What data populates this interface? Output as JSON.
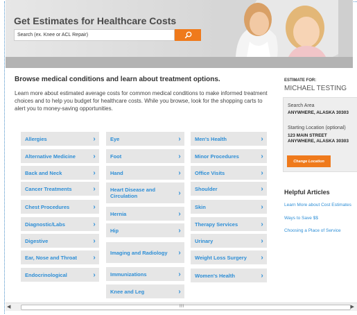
{
  "hero": {
    "title": "Get Estimates for Healthcare Costs",
    "search_placeholder": "Search (ex. Knee or ACL Repair)"
  },
  "main": {
    "title": "Browse medical conditions and learn about treatment options.",
    "description": "Learn more about estimated average costs for common medical conditions to make informed treatment choices and to help you budget for healthcare costs. While you browse, look for the shopping carts to alert you to money-saving opportunities."
  },
  "categories": {
    "col1": [
      "Allergies",
      "Alternative Medicine",
      "Back and Neck",
      "Cancer Treatments",
      "Chest Procedures",
      "Diagnostic/Labs",
      "Digestive",
      "Ear, Nose and Throat",
      "Endocrinological"
    ],
    "col2": [
      "Eye",
      "Foot",
      "Hand",
      "Heart Disease and Circulation",
      "Hernia",
      "Hip",
      "Imaging and Radiology",
      "Immunizations",
      "Knee and Leg"
    ],
    "col3": [
      "Men's Health",
      "Minor Procedures",
      "Office Visits",
      "Shoulder",
      "Skin",
      "Therapy Services",
      "Urinary",
      "Weight Loss Surgery",
      "Women's Health"
    ]
  },
  "sidebar": {
    "estimate_label": "ESTIMATE FOR:",
    "name": "MICHAEL TESTING",
    "search_area_label": "Search Area",
    "search_area_value": "ANYWHERE, ALASKA 30303",
    "starting_label": "Starting Location (optional)",
    "starting_line1": "123 MAIN STREET",
    "starting_line2": "ANYWHERE, ALASKA 30303",
    "change_button": "Change Location",
    "helpful_title": "Helpful Articles",
    "links": [
      "Learn More about Cost Estimates",
      "Ways to Save $$",
      "Choosing a Place of Service"
    ]
  },
  "scrollbar": {
    "grip": "III"
  },
  "colors": {
    "accent": "#ef7a1c",
    "link": "#2d8ed6",
    "tile": "#e6e6e6"
  }
}
